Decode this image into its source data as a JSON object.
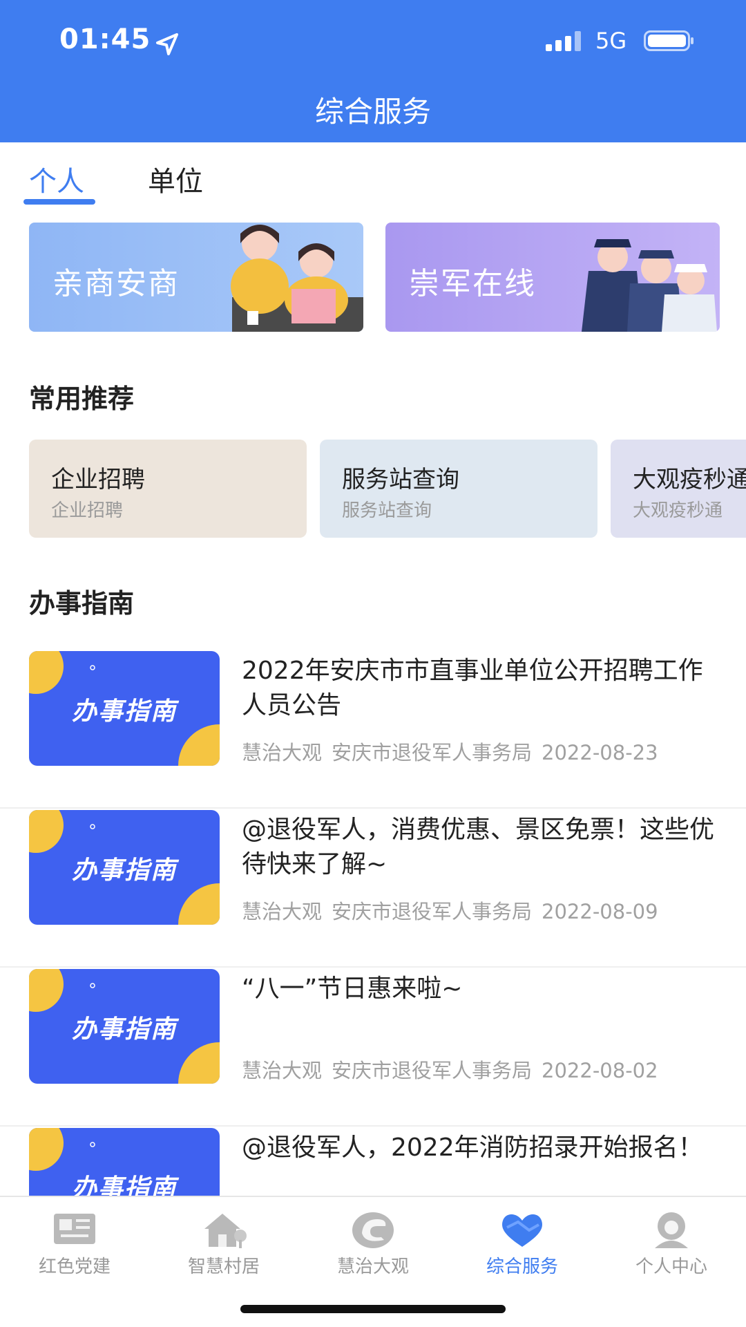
{
  "status_bar": {
    "time": "01:45",
    "network": "5G"
  },
  "header": {
    "title": "综合服务"
  },
  "tabs": [
    {
      "label": "个人",
      "active": true
    },
    {
      "label": "单位",
      "active": false
    }
  ],
  "banners": [
    {
      "label": "亲商安商"
    },
    {
      "label": "崇军在线"
    }
  ],
  "recommend": {
    "title": "常用推荐",
    "items": [
      {
        "title": "企业招聘",
        "subtitle": "企业招聘"
      },
      {
        "title": "服务站查询",
        "subtitle": "服务站查询"
      },
      {
        "title": "大观疫秒通",
        "subtitle": "大观疫秒通"
      }
    ]
  },
  "guide": {
    "title": "办事指南",
    "thumb_label": "办事指南",
    "items": [
      {
        "title": "2022年安庆市市直事业单位公开招聘工作人员公告",
        "source": "慧治大观",
        "dept": "安庆市退役军人事务局",
        "date": "2022-08-23"
      },
      {
        "title": "@退役军人，消费优惠、景区免票！这些优待快来了解~",
        "source": "慧治大观",
        "dept": "安庆市退役军人事务局",
        "date": "2022-08-09"
      },
      {
        "title": "“八一”节日惠来啦~",
        "source": "慧治大观",
        "dept": "安庆市退役军人事务局",
        "date": "2022-08-02"
      },
      {
        "title": "@退役军人，2022年消防招录开始报名！",
        "source": "",
        "dept": "",
        "date": ""
      }
    ]
  },
  "tabbar": {
    "items": [
      {
        "label": "红色党建",
        "icon": "party-building-icon",
        "active": false
      },
      {
        "label": "智慧村居",
        "icon": "village-house-icon",
        "active": false
      },
      {
        "label": "慧治大观",
        "icon": "governance-logo-icon",
        "active": false
      },
      {
        "label": "综合服务",
        "icon": "service-heart-icon",
        "active": true
      },
      {
        "label": "个人中心",
        "icon": "user-center-icon",
        "active": false
      }
    ]
  },
  "colors": {
    "primary": "#3f7df0",
    "thumb_blue": "#3f61f0",
    "thumb_yellow": "#f5c542",
    "muted": "#999999"
  }
}
